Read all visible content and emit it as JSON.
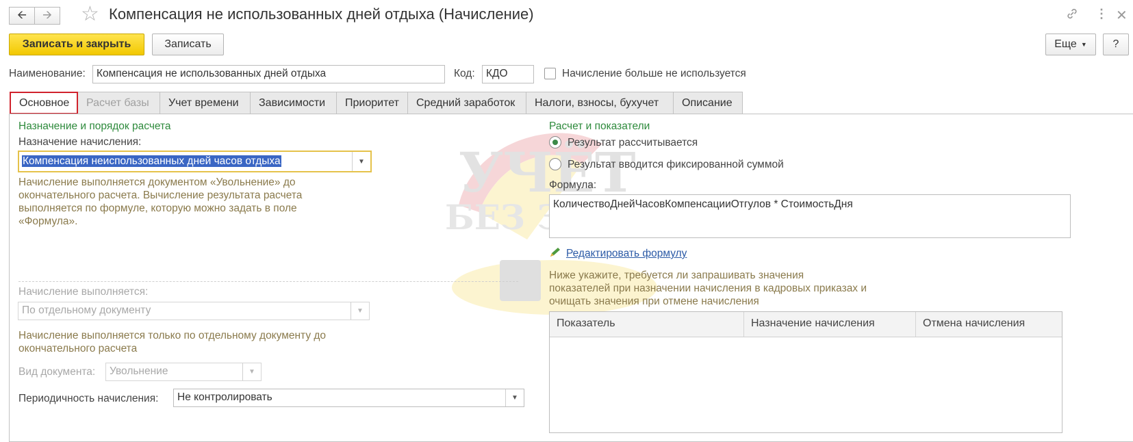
{
  "header": {
    "title": "Компенсация не использованных дней отдыха (Начисление)",
    "back_icon": "arrow-left",
    "forward_icon": "arrow-right"
  },
  "toolbar": {
    "save_close_label": "Записать и закрыть",
    "save_label": "Записать",
    "more_label": "Еще",
    "help_label": "?"
  },
  "form": {
    "name_label": "Наименование:",
    "name_value": "Компенсация не использованных дней отдыха",
    "code_label": "Код:",
    "code_value": "КДО",
    "unused_label": "Начисление больше не используется"
  },
  "tabs": [
    {
      "label": "Основное"
    },
    {
      "label": "Расчет базы"
    },
    {
      "label": "Учет времени"
    },
    {
      "label": "Зависимости"
    },
    {
      "label": "Приоритет"
    },
    {
      "label": "Средний заработок"
    },
    {
      "label": "Налоги, взносы, бухучет"
    },
    {
      "label": "Описание"
    }
  ],
  "left": {
    "section_title": "Назначение и порядок расчета",
    "purpose_label": "Назначение начисления:",
    "purpose_value": "Компенсация неиспользованных дней часов отдыха",
    "purpose_hint": [
      "Начисление выполняется документом «Увольнение» до",
      "окончательного расчета. Вычисление результата расчета",
      "выполняется по формуле, которую можно задать в поле",
      "«Формула»."
    ],
    "performed_label": "Начисление выполняется:",
    "performed_value": "По отдельному документу",
    "performed_hint": [
      "Начисление выполняется только по отдельному документу до",
      "окончательного расчета"
    ],
    "doctype_label": "Вид документа:",
    "doctype_value": "Увольнение",
    "periodicity_label": "Периодичность начисления:",
    "periodicity_value": "Не контролировать"
  },
  "right": {
    "section_title": "Расчет и показатели",
    "radio_calc": "Результат рассчитывается",
    "radio_fixed": "Результат вводится фиксированной суммой",
    "formula_label": "Формула:",
    "formula_value": "КоличествоДнейЧасовКомпенсацииОтгулов * СтоимостьДня",
    "edit_formula": "Редактировать формулу",
    "hint": [
      "Ниже укажите, требуется ли запрашивать значения",
      "показателей при назначении начисления в кадровых приказах и",
      "очищать значения при отмене начисления"
    ],
    "table_headers": [
      "Показатель",
      "Назначение начисления",
      "Отмена начисления"
    ]
  },
  "watermark": {
    "line1": "УЧЁТ",
    "line2": "БЕЗ ЗАБОТ"
  }
}
